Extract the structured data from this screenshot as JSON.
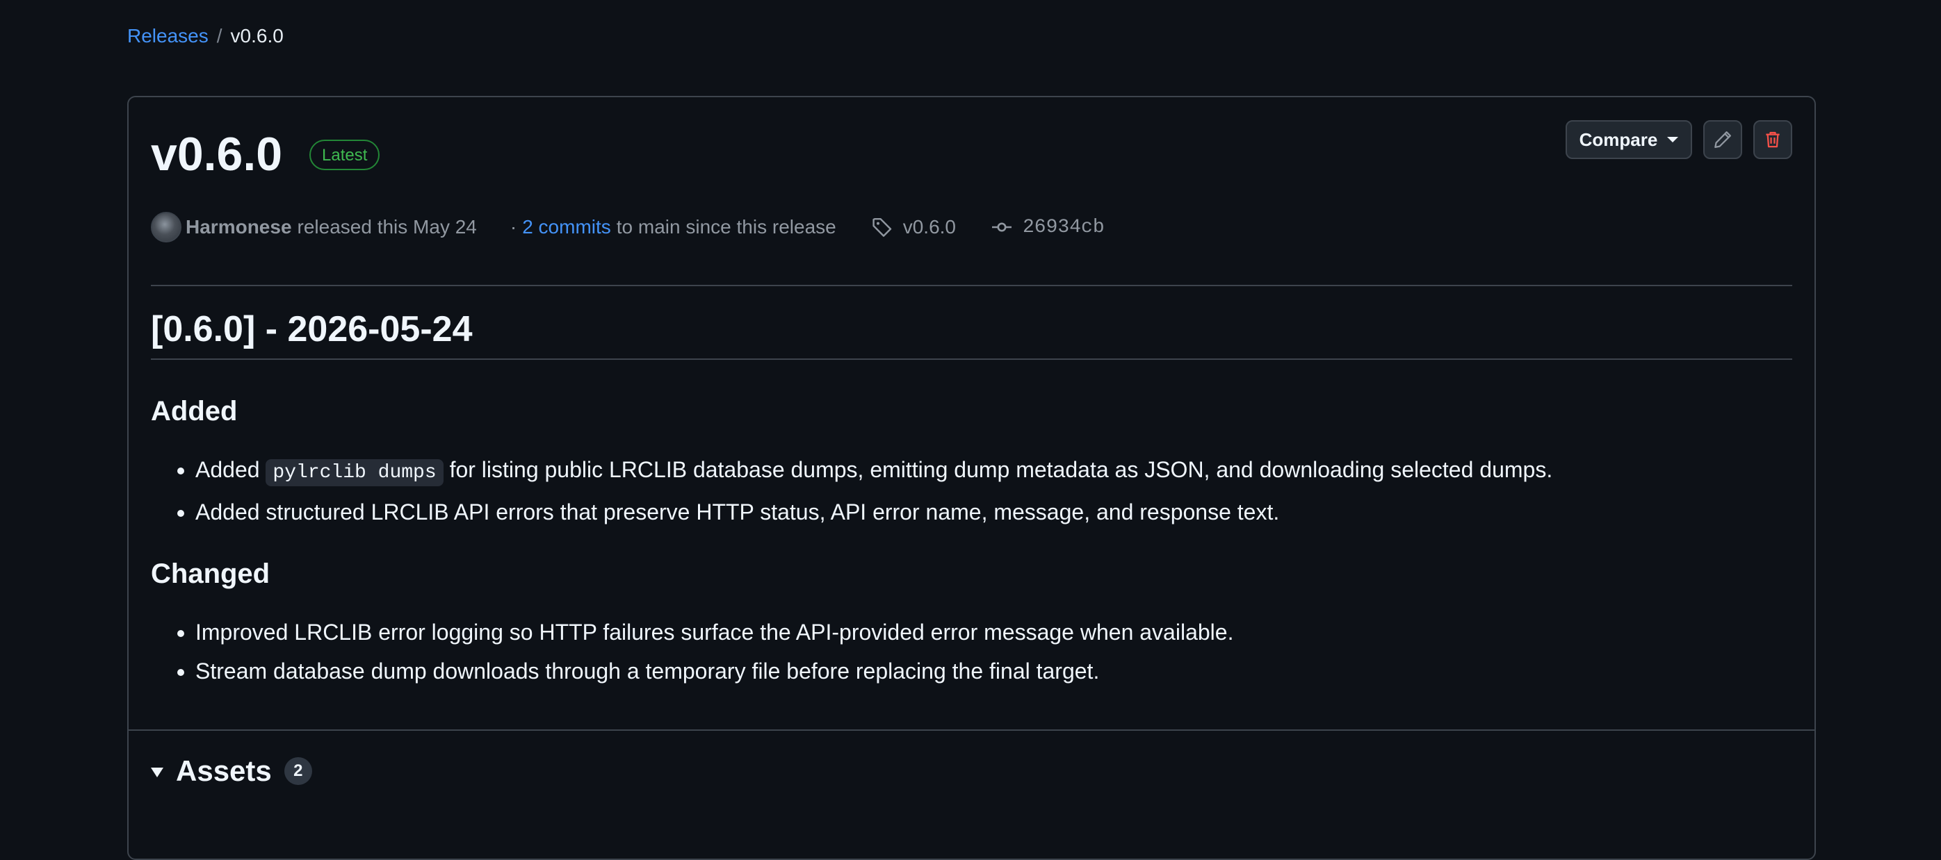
{
  "breadcrumb": {
    "root": "Releases",
    "separator": "/",
    "current": "v0.6.0"
  },
  "release": {
    "title": "v0.6.0",
    "badge": "Latest",
    "author": "Harmonese",
    "released_text": "released this May 24",
    "dot": "·",
    "commits_link": "2 commits",
    "commits_suffix": "to main since this release",
    "tag": "v0.6.0",
    "commit": "26934cb"
  },
  "actions": {
    "compare_label": "Compare",
    "edit_icon": "pencil-icon",
    "delete_icon": "trash-icon",
    "delete_color": "#f85149"
  },
  "notes": {
    "heading": "[0.6.0] - 2026-05-24",
    "added_heading": "Added",
    "added_items": [
      {
        "prefix": "Added",
        "code": "pylrclib dumps",
        "suffix": "for listing public LRCLIB database dumps, emitting dump metadata as JSON, and downloading selected dumps."
      },
      {
        "text": "Added structured LRCLIB API errors that preserve HTTP status, API error name, message, and response text."
      }
    ],
    "changed_heading": "Changed",
    "changed_items": [
      "Improved LRCLIB error logging so HTTP failures surface the API-provided error message when available.",
      "Stream database dump downloads through a temporary file before replacing the final target."
    ]
  },
  "assets": {
    "label": "Assets",
    "count": "2"
  }
}
